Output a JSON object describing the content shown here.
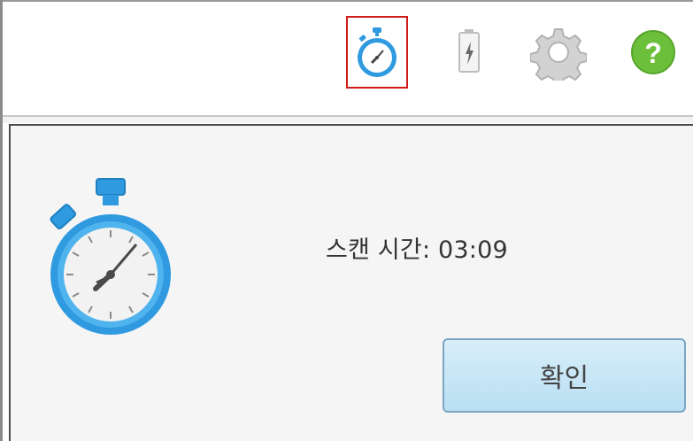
{
  "toolbar": {
    "icons": [
      {
        "name": "stopwatch-icon",
        "highlighted": true
      },
      {
        "name": "battery-charging-icon"
      },
      {
        "name": "gear-icon"
      },
      {
        "name": "help-icon",
        "glyph": "?"
      }
    ]
  },
  "dialog": {
    "scan_time_label": "스캔 시간: 03:09",
    "ok_label": "확인"
  },
  "colors": {
    "highlight": "#d11a1a",
    "stopwatch_blue": "#2f9ae0",
    "help_green": "#6cbf3b",
    "button_fill": "#c3e4f6"
  }
}
